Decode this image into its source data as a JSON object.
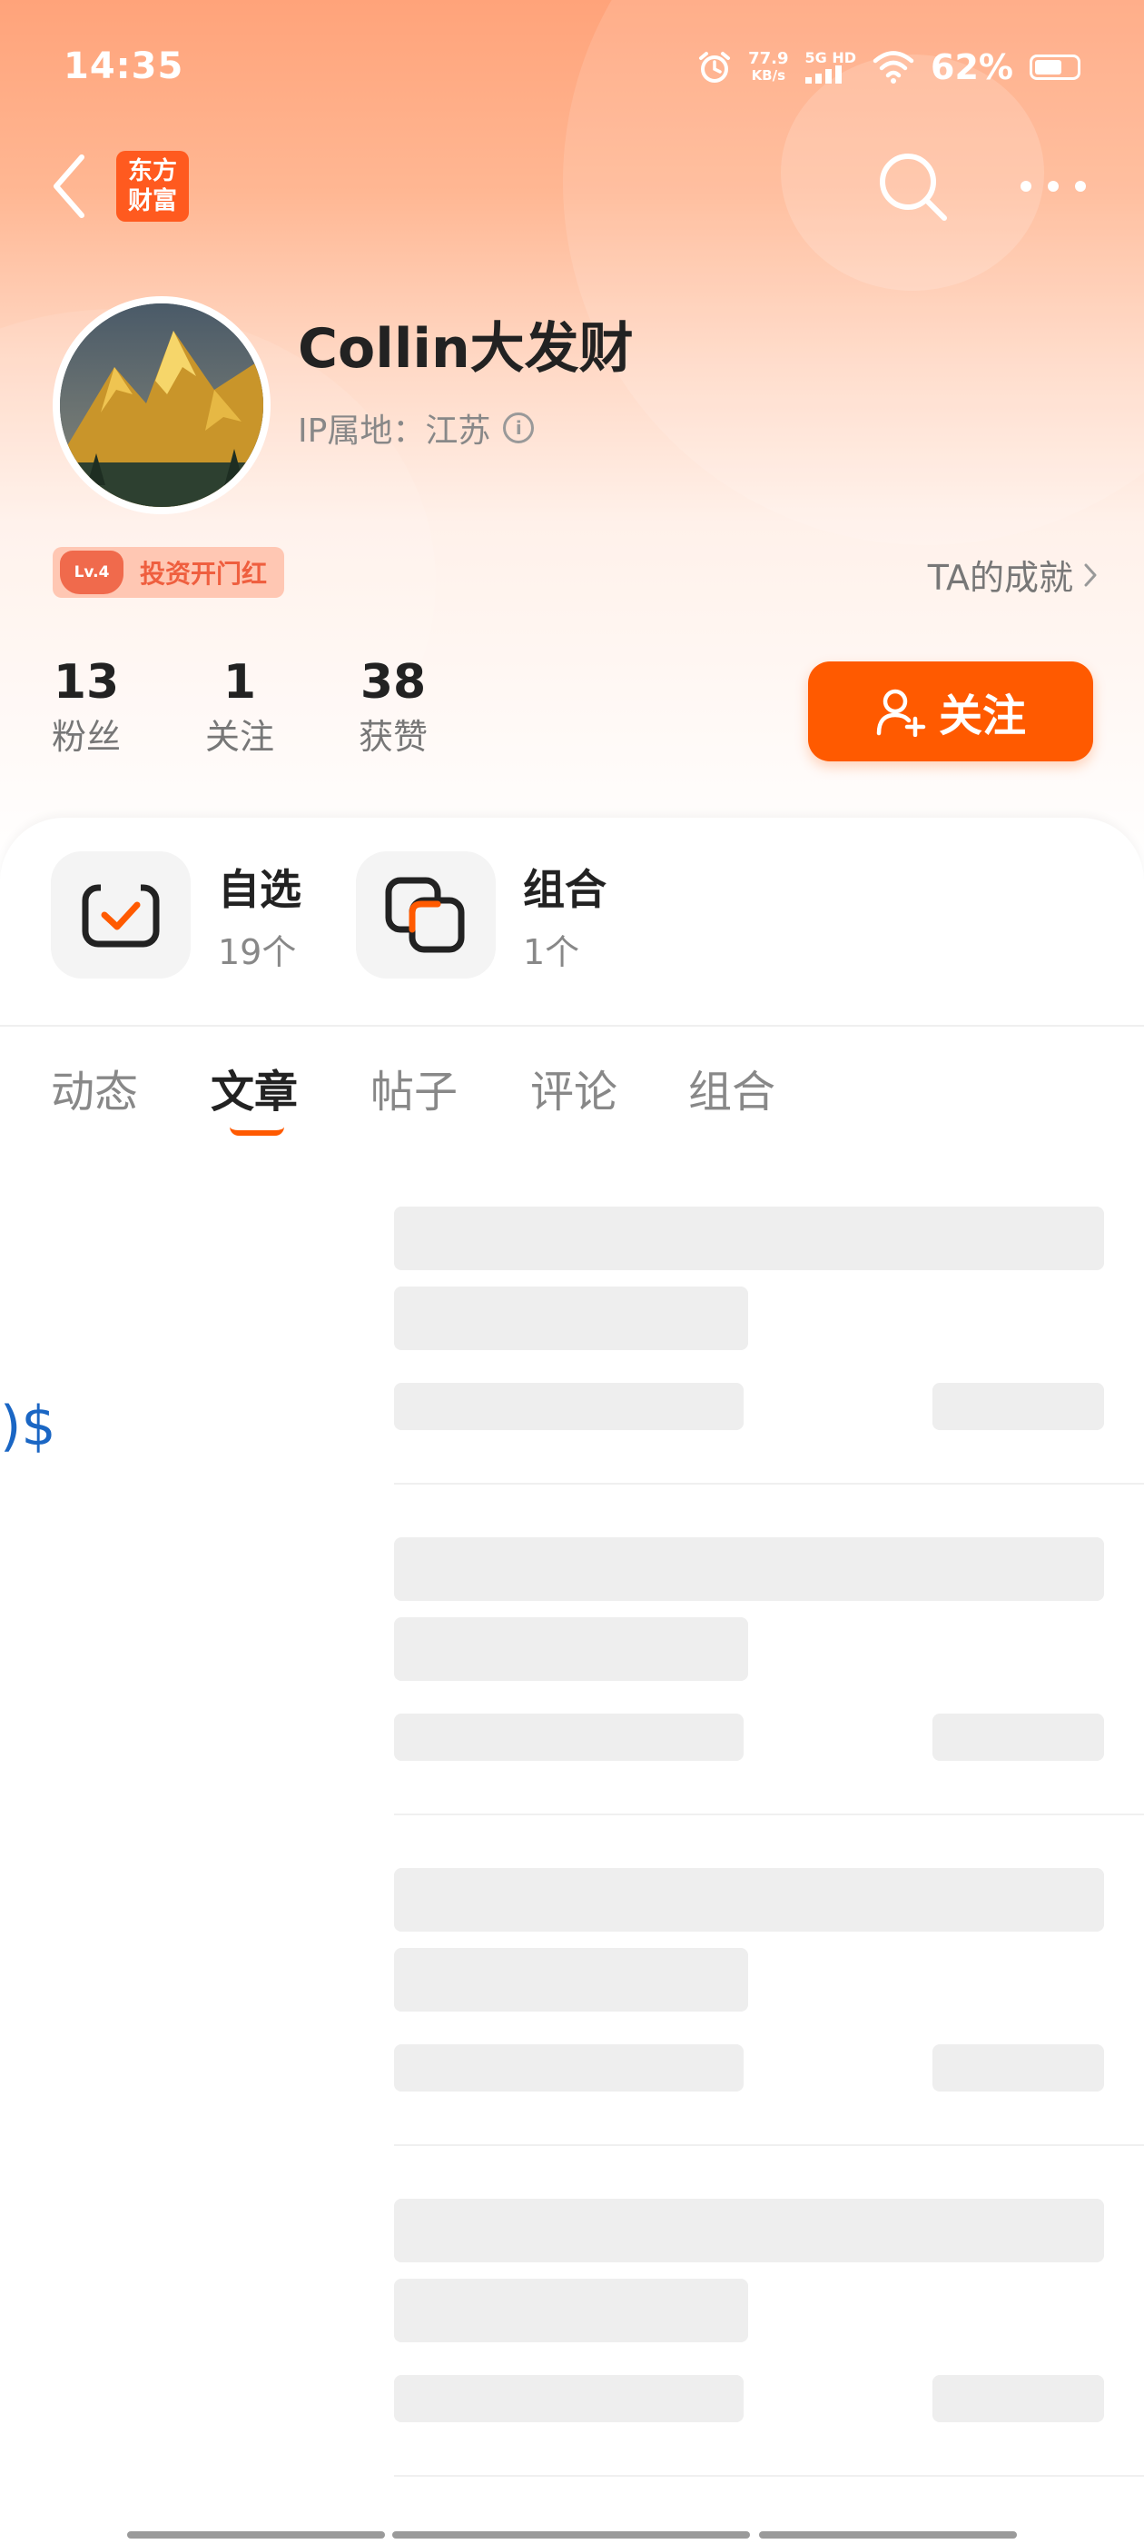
{
  "status_bar": {
    "time": "14:35",
    "net_speed_value": "77.9",
    "net_speed_unit": "KB/s",
    "network": "5G HD",
    "battery": "62%",
    "battery_level": 0.62
  },
  "nav": {
    "logo_line1": "东方",
    "logo_line2": "财富"
  },
  "profile": {
    "username": "Collin大发财",
    "ip_location": "IP属地：江苏",
    "badge_level": "Lv.4",
    "badge_title": "投资开门红",
    "achievements_link": "TA的成就"
  },
  "stats": [
    {
      "value": "13",
      "label": "粉丝"
    },
    {
      "value": "1",
      "label": "关注"
    },
    {
      "value": "38",
      "label": "获赞"
    }
  ],
  "follow_button": "关注",
  "quick_entries": [
    {
      "title": "自选",
      "count": "19个"
    },
    {
      "title": "组合",
      "count": "1个"
    }
  ],
  "tabs": [
    "动态",
    "文章",
    "帖子",
    "评论",
    "组合"
  ],
  "active_tab": "文章",
  "content_fragment": ")$",
  "colors": {
    "accent": "#ff5a00",
    "badge_text": "#ef5f3f",
    "skeleton": "#eeeeee",
    "link_blue": "#1a66c4"
  }
}
